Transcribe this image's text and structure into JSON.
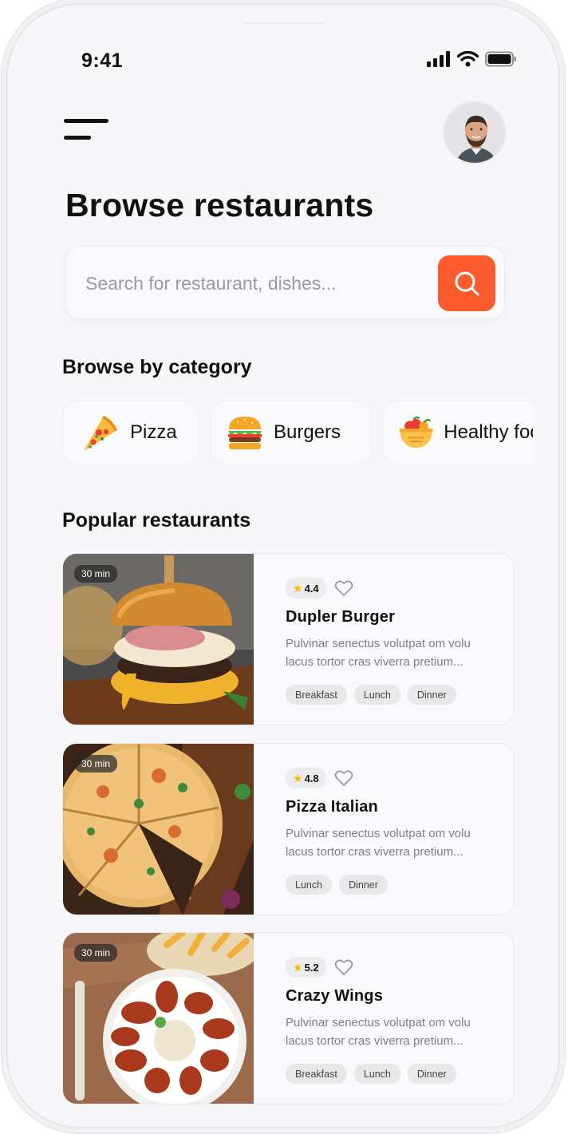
{
  "status": {
    "time": "9:41"
  },
  "header": {
    "title": "Browse restaurants"
  },
  "search": {
    "placeholder": "Search for restaurant, dishes..."
  },
  "categories_section": {
    "title": "Browse by category",
    "items": [
      {
        "label": "Pizza",
        "icon": "pizza-slice-icon"
      },
      {
        "label": "Burgers",
        "icon": "burger-icon"
      },
      {
        "label": "Healthy food",
        "icon": "salad-bowl-icon"
      }
    ]
  },
  "popular_section": {
    "title": "Popular restaurants",
    "restaurants": [
      {
        "time": "30 min",
        "rating": "4.4",
        "name": "Dupler Burger",
        "desc_line1": "Pulvinar senectus volutpat om volu",
        "desc_line2": "lacus tortor cras viverra pretium...",
        "tags": [
          "Breakfast",
          "Lunch",
          "Dinner"
        ]
      },
      {
        "time": "30 min",
        "rating": "4.8",
        "name": "Pizza Italian",
        "desc_line1": "Pulvinar senectus volutpat om volu",
        "desc_line2": "lacus tortor cras viverra pretium...",
        "tags": [
          "Lunch",
          "Dinner"
        ]
      },
      {
        "time": "30 min",
        "rating": "5.2",
        "name": "Crazy Wings",
        "desc_line1": "Pulvinar senectus volutpat om volu",
        "desc_line2": "lacus tortor cras viverra pretium...",
        "tags": [
          "Breakfast",
          "Lunch",
          "Dinner"
        ]
      }
    ]
  },
  "colors": {
    "accent": "#fd5a2e",
    "background": "#f7f7f9",
    "star": "#f5b800"
  }
}
